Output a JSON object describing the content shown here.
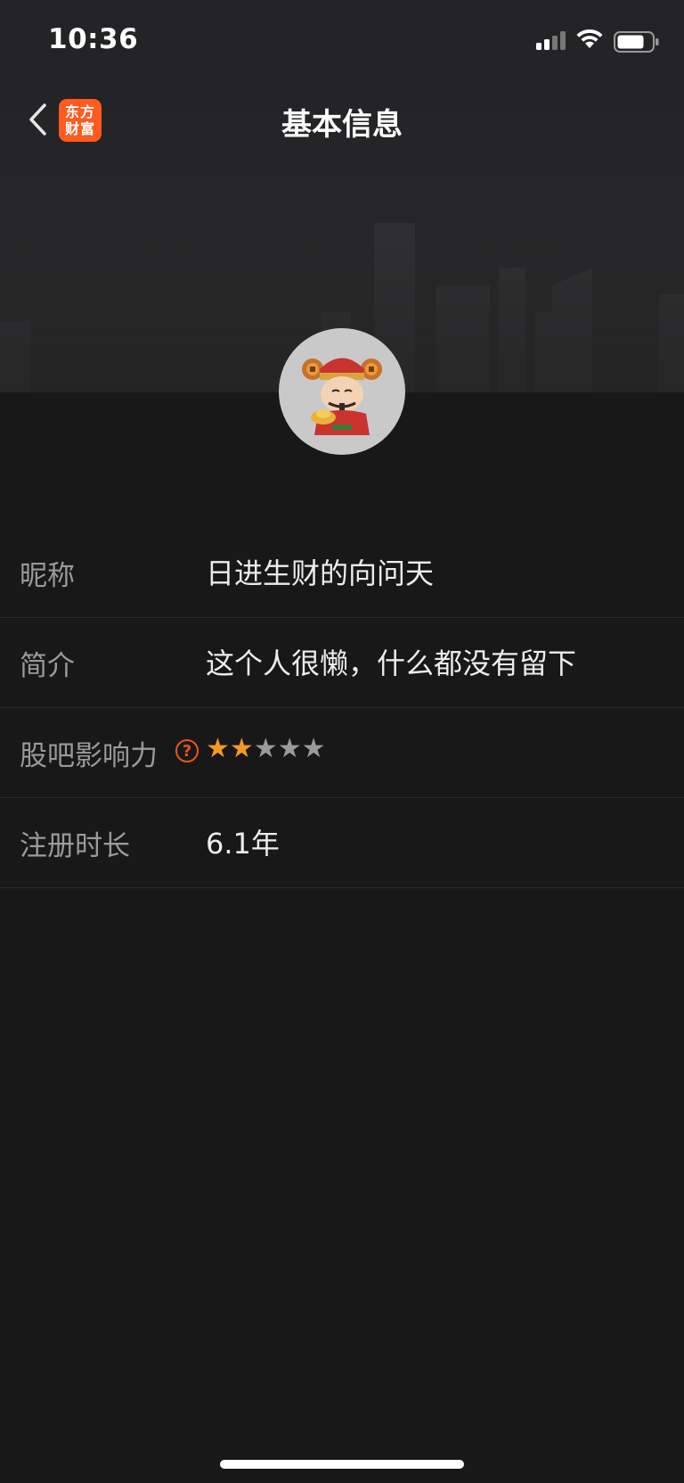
{
  "status_bar": {
    "time": "10:36"
  },
  "nav": {
    "title": "基本信息",
    "logo_line1": "东方",
    "logo_line2": "财富",
    "back_icon": "chevron-left-icon"
  },
  "colors": {
    "accent": "#ff5a1f",
    "star_active": "#f39a26",
    "star_inactive": "#9b9b9b",
    "background": "#181818"
  },
  "profile": {
    "rows": [
      {
        "label": "昵称",
        "value": "日进生财的向问天"
      },
      {
        "label": "简介",
        "value": "这个人很懒，什么都没有留下"
      },
      {
        "label": "股吧影响力",
        "help_icon": "question-circle-icon",
        "rating": 2,
        "rating_max": 5
      },
      {
        "label": "注册时长",
        "value": "6.1年"
      }
    ]
  }
}
